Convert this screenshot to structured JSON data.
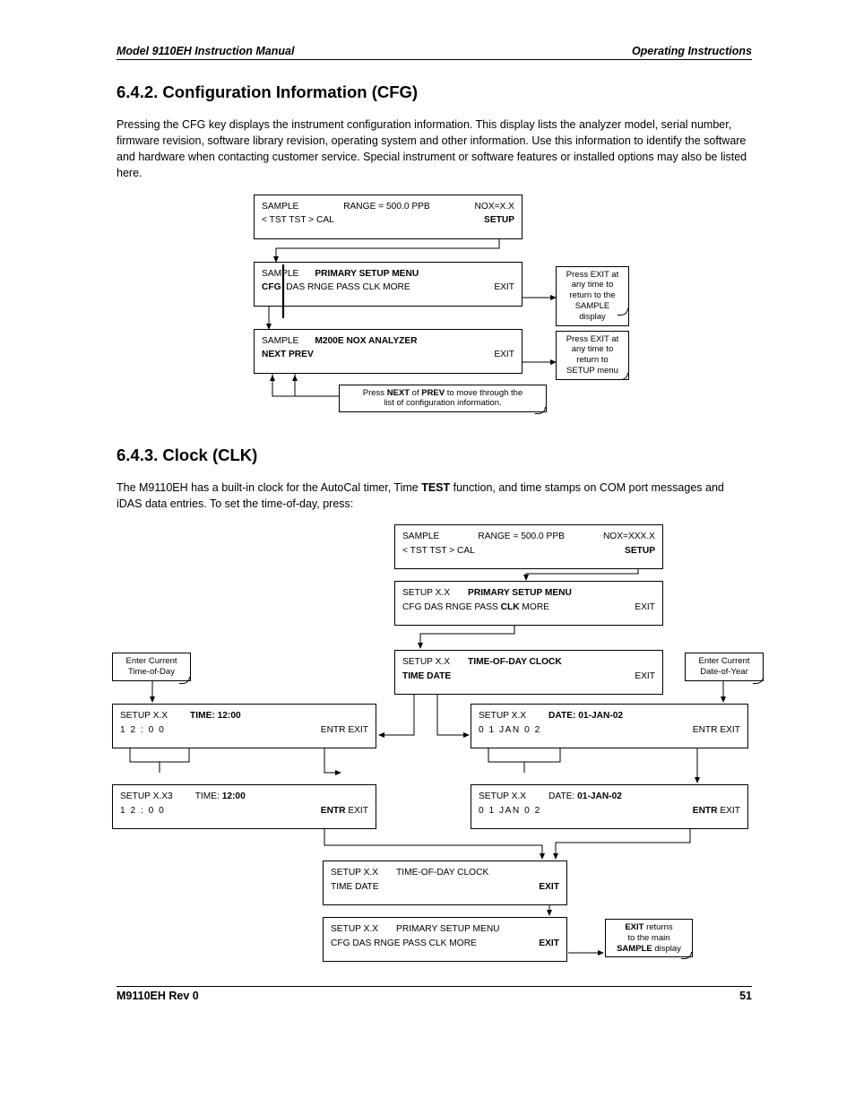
{
  "header": {
    "left": "Model 9110EH Instruction Manual",
    "right": "Operating Instructions"
  },
  "s1": {
    "heading": "6.4.2. Configuration Information (CFG)",
    "para": "Pressing the CFG key displays the instrument configuration information. This display lists the analyzer model, serial number, firmware revision, software library revision, operating system and other information. Use this information to identify the software and hardware when contacting customer service. Special instrument or software features or installed options may also be listed here.",
    "b1": {
      "l": "SAMPLE",
      "c": "RANGE = 500.0 PPB",
      "r": "NOX=X.X",
      "row2l": "< TST  TST >  CAL",
      "row2r": "SETUP"
    },
    "b2": {
      "l": "SAMPLE",
      "c": "PRIMARY SETUP MENU",
      "row2l": "CFG",
      "row2m": "DAS  RNGE  PASS  CLK  MORE",
      "row2r": "EXIT"
    },
    "b3": {
      "l": "SAMPLE",
      "c": "M200E NOX ANALYZER",
      "row2l": "NEXT   PREV",
      "row2r": "EXIT"
    },
    "note1l1": "Press EXIT at",
    "note1l2": "any time to",
    "note1l3": "return to the",
    "note1l4": "SAMPLE display",
    "note2l1": "Press EXIT at",
    "note2l2": "any time to",
    "note2l3": "return to",
    "note2l4": "SETUP menu",
    "note3a": "Press ",
    "note3b": "NEXT",
    "note3c": " of ",
    "note3d": "PREV",
    "note3e": " to move through the",
    "note3l2": "list of configuration information."
  },
  "s2": {
    "heading": "6.4.3. Clock (CLK)",
    "para1a": "The M9110EH has a built-in clock for the AutoCal timer, Time ",
    "para1b": "TEST",
    "para1c": " function, and time stamps on COM port messages and iDAS data entries. To set the time-of-day, press:",
    "c1": {
      "l": "SAMPLE",
      "c": "RANGE = 500.0 PPB",
      "r": "NOX=XXX.X",
      "row2l": "< TST  TST >  CAL",
      "row2r": "SETUP"
    },
    "c2": {
      "l": "SETUP X.X",
      "c": "PRIMARY SETUP MENU",
      "row2l": "CFG  DAS  RNGE  PASS ",
      "row2m": "CLK",
      "row2n": " MORE",
      "row2r": "EXIT"
    },
    "c3": {
      "l": "SETUP X.X",
      "c": "TIME-OF-DAY CLOCK",
      "row2l": "TIME  DATE",
      "row2r": "EXIT"
    },
    "tl": {
      "l": "SETUP X.X",
      "c": "TIME: 12:00",
      "row2l": "1  2   :  0  0",
      "row2r": "ENTR EXIT"
    },
    "dl": {
      "l": "SETUP X.X",
      "c": "DATE: 01-JAN-02",
      "row2l": "0  1   JAN   0  2",
      "row2r": "ENTR EXIT"
    },
    "tl2": {
      "l": "SETUP X.X3",
      "c1": "TIME: ",
      "c2": "12:00",
      "row2l": "1  2   :  0  0",
      "row2r1": "ENTR",
      "row2r2": " EXIT"
    },
    "dl2": {
      "l": "SETUP X.X",
      "c1": "DATE: ",
      "c2": "01-JAN-02",
      "row2l": "0  1   JAN   0  2",
      "row2r1": "ENTR",
      "row2r2": " EXIT"
    },
    "c4": {
      "l": "SETUP X.X",
      "c": "TIME-OF-DAY CLOCK",
      "row2l": "TIME  DATE",
      "row2r": "EXIT"
    },
    "c5": {
      "l": "SETUP X.X",
      "c": "PRIMARY SETUP MENU",
      "row2l": "CFG  DAS  RNGE  PASS  CLK  MORE",
      "row2r": "EXIT"
    },
    "noteL1": "Enter Current",
    "noteL2": "Time-of-Day",
    "noteR1": "Enter Current",
    "noteR2": "Date-of-Year",
    "noteE1": "EXIT",
    "noteE2": " returns",
    "noteE3": "to the main",
    "noteE4": "SAMPLE",
    "noteE5": " display"
  },
  "footer": {
    "left": "M9110EH Rev 0",
    "right": "51"
  }
}
